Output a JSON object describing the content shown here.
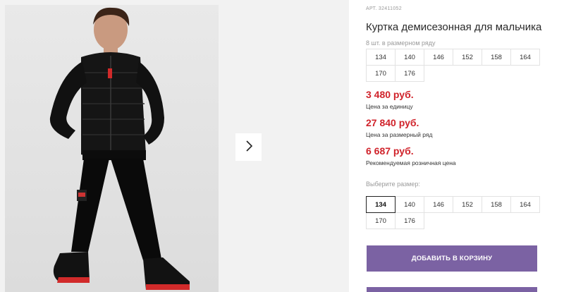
{
  "product": {
    "article": "АРТ. 32411052",
    "title": "Куртка демисезонная для мальчика",
    "pack_note": "8 шт. в размерном ряду",
    "pack_sizes": [
      "134",
      "140",
      "146",
      "152",
      "158",
      "164",
      "170",
      "176"
    ]
  },
  "prices": [
    {
      "value": "3 480 руб.",
      "label": "Цена за единицу"
    },
    {
      "value": "27 840 руб.",
      "label": "Цена за размерный ряд"
    },
    {
      "value": "6 687 руб.",
      "label": "Рекомендуемая розничная цена"
    }
  ],
  "size_picker": {
    "label": "Выберите размер:",
    "sizes": [
      "134",
      "140",
      "146",
      "152",
      "158",
      "164",
      "170",
      "176"
    ],
    "selected": "134"
  },
  "actions": {
    "add_to_cart": "ДОБАВИТЬ В КОРЗИНУ"
  },
  "gallery": {
    "next_icon": "chevron-right-icon",
    "photo": "boy-in-black-jacket-photo"
  },
  "colors": {
    "price": "#d0232b",
    "button": "#7b62a3"
  }
}
